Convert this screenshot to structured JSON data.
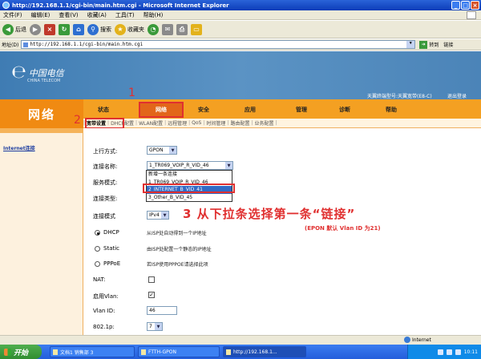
{
  "window": {
    "title": "http://192.168.1.1/cgi-bin/main.htm.cgi - Microsoft Internet Explorer",
    "controls": [
      "_",
      "□",
      "×"
    ]
  },
  "menu": [
    "文件(F)",
    "编辑(E)",
    "查看(V)",
    "收藏(A)",
    "工具(T)",
    "帮助(H)"
  ],
  "toolbar": {
    "back": "后退",
    "search": "搜索",
    "favorites": "收藏夹"
  },
  "address": {
    "label": "地址(D)",
    "url": "http://192.168.1.1/cgi-bin/main.htm.cgi",
    "go": "转到",
    "links": "链接"
  },
  "header": {
    "logo": "中国电信",
    "logo_sub": "CHINA TELECOM",
    "model": "天翼终端型号:天翼宽带(E8-C)",
    "logout": "退出登录"
  },
  "section_title": "网络",
  "nav": {
    "tabs": [
      "状态",
      "网络",
      "安全",
      "应用",
      "管理",
      "诊断",
      "帮助"
    ],
    "active": "网络"
  },
  "subnav": {
    "items": [
      "宽带设置",
      "DHCP配置",
      "WLAN配置",
      "远程管理",
      "QoS",
      "时间管理",
      "路由配置",
      "业务配置"
    ],
    "active": "宽带设置"
  },
  "sidebar": {
    "link": "Internet连接"
  },
  "form": {
    "upstream_label": "上行方式:",
    "upstream_value": "GPON",
    "conn_name_label": "连接名称:",
    "conn_name_value": "1_TR069_VOIP_R_VID_46",
    "service_mode_label": "服务模式:",
    "conn_type_label": "连接类型:",
    "conn_mode_label": "连接模式",
    "conn_mode_value": "IPv4",
    "dropdown_options": [
      "新增一条连接",
      "1_TR069_VOIP_R_VID_46",
      "2_INTERNET_B_VID_41",
      "3_Other_B_VID_45"
    ],
    "dropdown_selected": "2_INTERNET_B_VID_41",
    "radio_dhcp": "DHCP",
    "radio_dhcp_desc": "从ISP处自动得到一个IP地址",
    "radio_static": "Static",
    "radio_static_desc": "由ISP处配置一个静态的IP地址",
    "radio_pppoe": "PPPoE",
    "radio_pppoe_desc": "若ISP使用PPPOE请选择此项",
    "nat_label": "NAT:",
    "vlan_enable_label": "启用Vlan:",
    "vlan_id_label": "Vlan ID:",
    "vlan_id_value": "46",
    "p8021_label": "802.1p:",
    "p8021_value": "7"
  },
  "annotations": {
    "step1": "1",
    "step2": "2",
    "step3": "3 从下拉条选择第一条“链接”",
    "note": "(EPON 默认 Vlan ID 为21)"
  },
  "statusbar": {
    "zone": "Internet"
  },
  "taskbar": {
    "start": "开始",
    "tasks": [
      "文档1 销售部 3",
      "FTTH-GPON",
      "http://192.168.1..."
    ],
    "clock": "10:11"
  }
}
